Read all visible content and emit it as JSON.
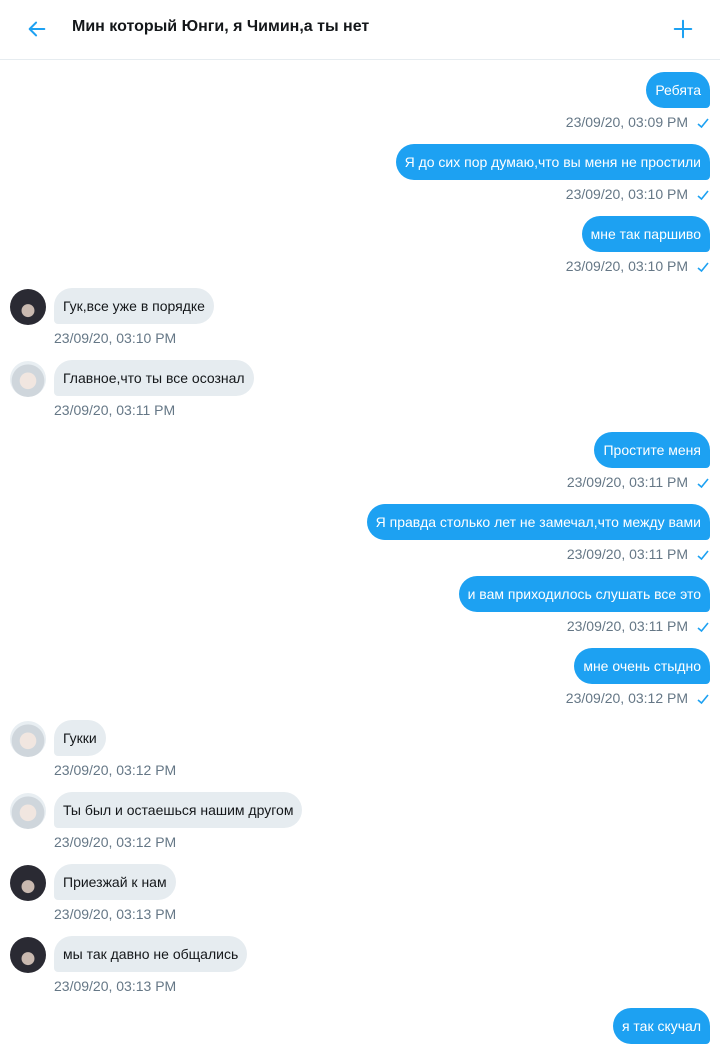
{
  "header": {
    "title": "Мин который Юнги, я Чимин,а ты нет",
    "back_icon": "arrow-left-icon",
    "add_icon": "plus-icon",
    "accent": "#1da1f2"
  },
  "messages": [
    {
      "dir": "out",
      "text": "Ребята",
      "time": "23/09/20, 03:09 PM"
    },
    {
      "dir": "out",
      "text": "Я до сих пор думаю,что вы меня не простили",
      "time": "23/09/20, 03:10 PM"
    },
    {
      "dir": "out",
      "text": "мне так паршиво",
      "time": "23/09/20, 03:10 PM"
    },
    {
      "dir": "in",
      "avatar": "dark",
      "text": "Гук,все уже в порядке",
      "time": "23/09/20, 03:10 PM"
    },
    {
      "dir": "in",
      "avatar": "light",
      "text": "Главное,что ты все осознал",
      "time": "23/09/20, 03:11 PM"
    },
    {
      "dir": "out",
      "text": "Простите меня",
      "time": "23/09/20, 03:11 PM"
    },
    {
      "dir": "out",
      "text": "Я правда столько лет не замечал,что между вами",
      "time": "23/09/20, 03:11 PM"
    },
    {
      "dir": "out",
      "text": "и вам приходилось слушать все это",
      "time": "23/09/20, 03:11 PM"
    },
    {
      "dir": "out",
      "text": "мне очень стыдно",
      "time": "23/09/20, 03:12 PM"
    },
    {
      "dir": "in",
      "avatar": "light",
      "text": "Гукки",
      "time": "23/09/20, 03:12 PM"
    },
    {
      "dir": "in",
      "avatar": "light",
      "text": "Ты был и остаешься нашим другом",
      "time": "23/09/20, 03:12 PM"
    },
    {
      "dir": "in",
      "avatar": "dark",
      "text": "Приезжай к нам",
      "time": "23/09/20, 03:13 PM"
    },
    {
      "dir": "in",
      "avatar": "dark",
      "text": "мы так давно не общались",
      "time": "23/09/20, 03:13 PM"
    },
    {
      "dir": "out",
      "text": "я так скучал",
      "time": ""
    }
  ]
}
